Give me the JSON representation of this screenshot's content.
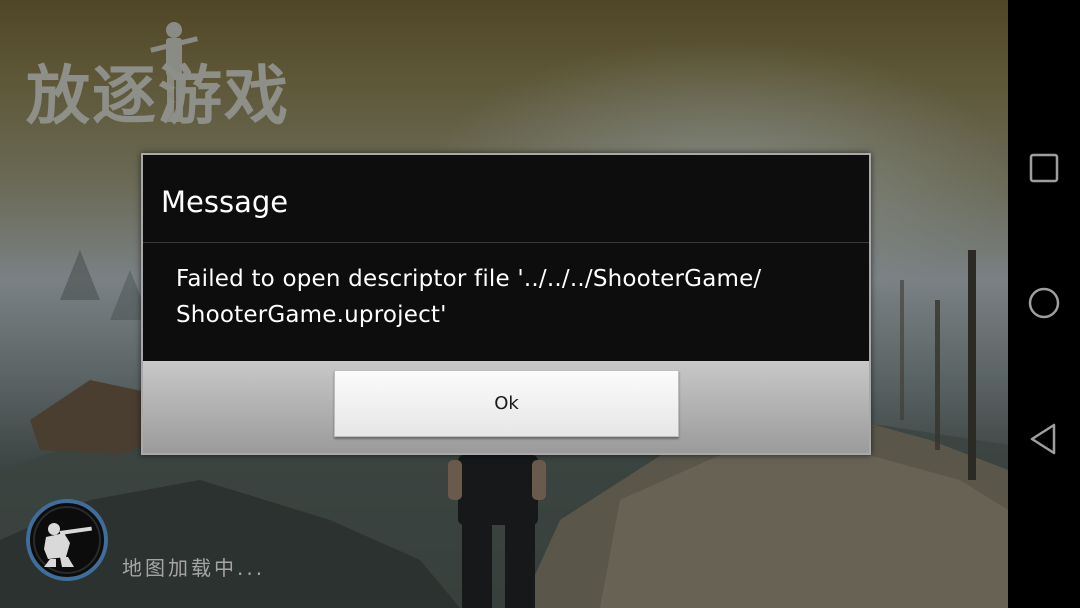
{
  "game": {
    "logo_text": "放逐游戏",
    "loading_text": "地图加载中..."
  },
  "dialog": {
    "title": "Message",
    "message": "Failed to open descriptor file '../../../ShooterGame/ ShooterGame.uproject'",
    "ok_label": "Ok"
  },
  "nav_bar": {
    "buttons": [
      {
        "icon": "square-recents-icon"
      },
      {
        "icon": "circle-home-icon"
      },
      {
        "icon": "triangle-back-icon"
      }
    ]
  },
  "colors": {
    "dialog_bg": "#0d0d0d",
    "dialog_footer": "#b4b4b4",
    "avatar_ring": "#3f6e9c",
    "nav_icon": "#9e9e9e"
  }
}
